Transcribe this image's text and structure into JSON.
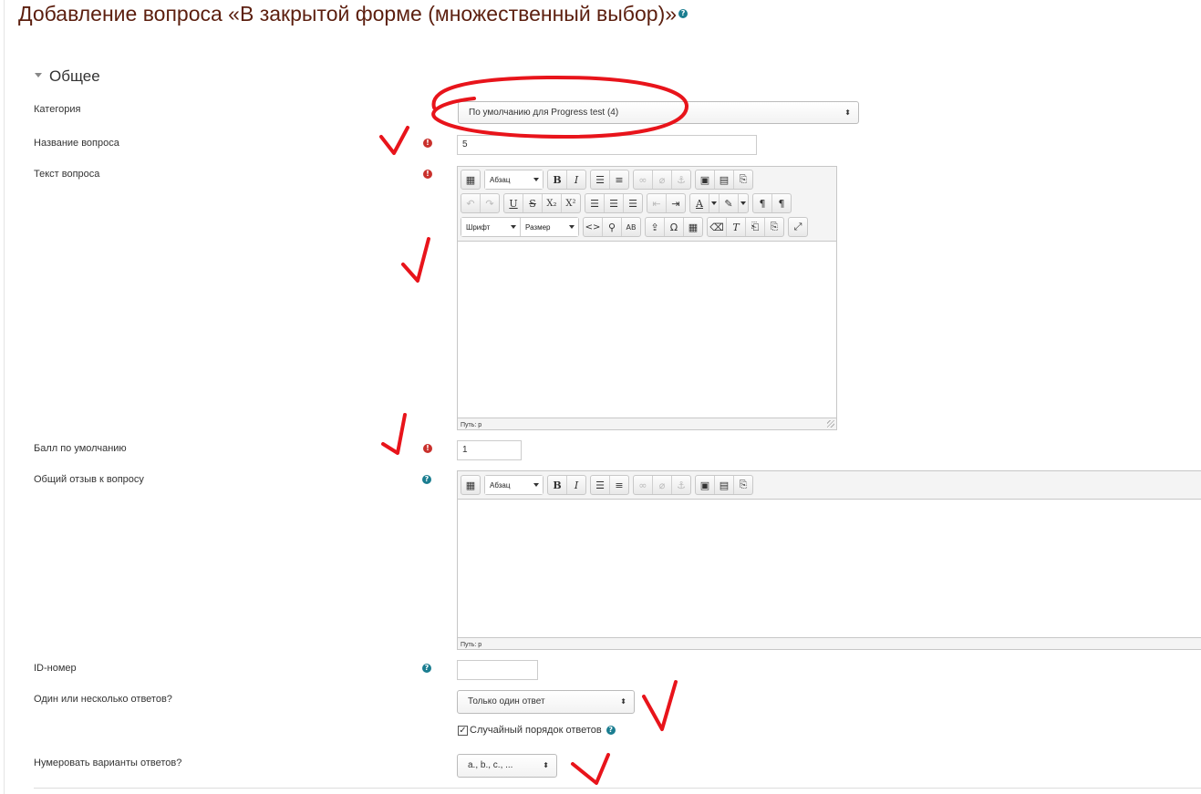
{
  "page": {
    "title": "Добавление вопроса «В закрытой форме (множественный выбор)»",
    "section_title": "Общее"
  },
  "form": {
    "category": {
      "label": "Категория",
      "value": "По умолчанию для Progress test (4)"
    },
    "question_name": {
      "label": "Название вопроса",
      "value": "5"
    },
    "question_text": {
      "label": "Текст вопроса",
      "path": "Путь: p"
    },
    "default_mark": {
      "label": "Балл по умолчанию",
      "value": "1"
    },
    "general_feedback": {
      "label": "Общий отзыв к вопросу",
      "path": "Путь: p"
    },
    "id_number": {
      "label": "ID-номер",
      "value": ""
    },
    "single_multiple": {
      "label": "Один или несколько ответов?",
      "value": "Только один ответ"
    },
    "shuffle": {
      "label": "Случайный порядок ответов",
      "checked": true
    },
    "numbering": {
      "label": "Нумеровать варианты ответов?",
      "value": "a., b., c., ..."
    }
  },
  "editor": {
    "format_dropdown": "Абзац",
    "font_dropdown": "Шрифт",
    "size_dropdown": "Размер"
  },
  "colors": {
    "title": "#5c1f0f",
    "required": "#c9302c",
    "help": "#1a7d90",
    "annotation": "#e8141b"
  }
}
